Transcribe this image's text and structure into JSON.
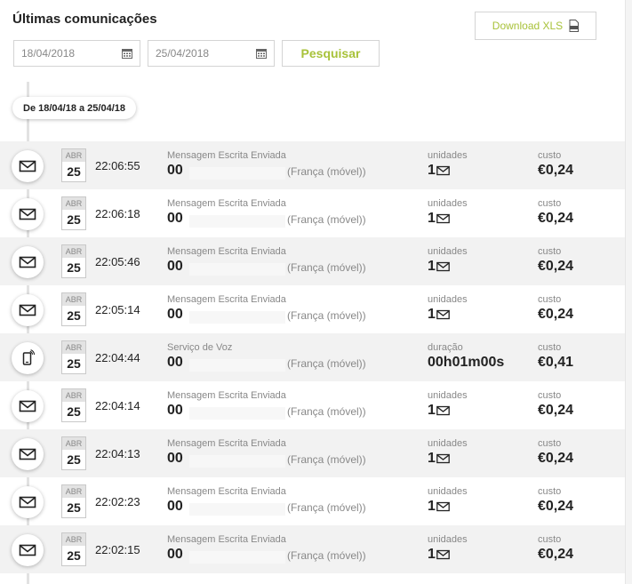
{
  "header": {
    "title": "Últimas comunicações",
    "download_label": "Download XLS"
  },
  "filters": {
    "date_from": "18/04/2018",
    "date_to": "25/04/2018",
    "search_label": "Pesquisar"
  },
  "range_label": "De 18/04/18 a 25/04/18",
  "colors": {
    "accent": "#a8c23a"
  },
  "communications": [
    {
      "type": "sms",
      "icon": "envelope-icon",
      "month": "ABR",
      "day": "25",
      "time": "22:06:55",
      "description": "Mensagem Escrita Enviada",
      "number": "00",
      "country": "(França (móvel))",
      "metric_label": "unidades",
      "metric_value": "1",
      "cost_label": "custo",
      "cost": "€0,24"
    },
    {
      "type": "sms",
      "icon": "envelope-icon",
      "month": "ABR",
      "day": "25",
      "time": "22:06:18",
      "description": "Mensagem Escrita Enviada",
      "number": "00",
      "country": "(França (móvel))",
      "metric_label": "unidades",
      "metric_value": "1",
      "cost_label": "custo",
      "cost": "€0,24"
    },
    {
      "type": "sms",
      "icon": "envelope-icon",
      "month": "ABR",
      "day": "25",
      "time": "22:05:46",
      "description": "Mensagem Escrita Enviada",
      "number": "00",
      "country": "(França (móvel))",
      "metric_label": "unidades",
      "metric_value": "1",
      "cost_label": "custo",
      "cost": "€0,24"
    },
    {
      "type": "sms",
      "icon": "envelope-icon",
      "month": "ABR",
      "day": "25",
      "time": "22:05:14",
      "description": "Mensagem Escrita Enviada",
      "number": "00",
      "country": "(França (móvel))",
      "metric_label": "unidades",
      "metric_value": "1",
      "cost_label": "custo",
      "cost": "€0,24"
    },
    {
      "type": "voice",
      "icon": "phone-icon",
      "month": "ABR",
      "day": "25",
      "time": "22:04:44",
      "description": "Serviço de Voz",
      "number": "00",
      "country": "(França (móvel))",
      "metric_label": "duração",
      "metric_value": "00h01m00s",
      "cost_label": "custo",
      "cost": "€0,41"
    },
    {
      "type": "sms",
      "icon": "envelope-icon",
      "month": "ABR",
      "day": "25",
      "time": "22:04:14",
      "description": "Mensagem Escrita Enviada",
      "number": "00",
      "country": "(França (móvel))",
      "metric_label": "unidades",
      "metric_value": "1",
      "cost_label": "custo",
      "cost": "€0,24"
    },
    {
      "type": "sms",
      "icon": "envelope-icon",
      "month": "ABR",
      "day": "25",
      "time": "22:04:13",
      "description": "Mensagem Escrita Enviada",
      "number": "00",
      "country": "(França (móvel))",
      "metric_label": "unidades",
      "metric_value": "1",
      "cost_label": "custo",
      "cost": "€0,24"
    },
    {
      "type": "sms",
      "icon": "envelope-icon",
      "month": "ABR",
      "day": "25",
      "time": "22:02:23",
      "description": "Mensagem Escrita Enviada",
      "number": "00",
      "country": "(França (móvel))",
      "metric_label": "unidades",
      "metric_value": "1",
      "cost_label": "custo",
      "cost": "€0,24"
    },
    {
      "type": "sms",
      "icon": "envelope-icon",
      "month": "ABR",
      "day": "25",
      "time": "22:02:15",
      "description": "Mensagem Escrita Enviada",
      "number": "00",
      "country": "(França (móvel))",
      "metric_label": "unidades",
      "metric_value": "1",
      "cost_label": "custo",
      "cost": "€0,24"
    }
  ]
}
